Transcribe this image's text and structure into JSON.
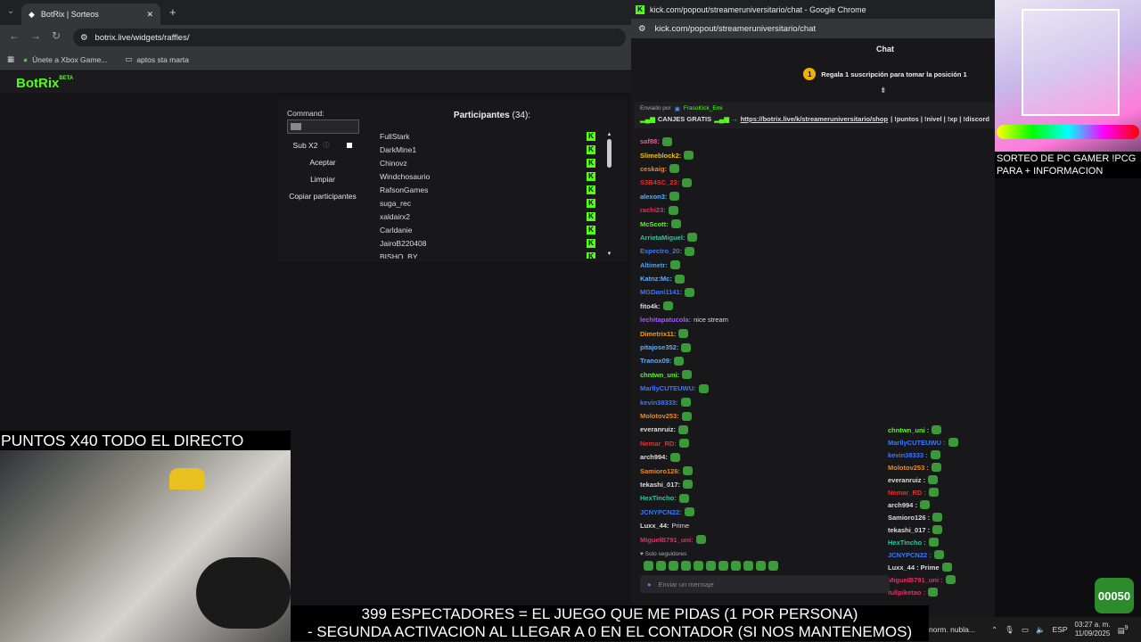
{
  "left_browser": {
    "tab_title": "BotRix | Sorteos",
    "url": "botrix.live/widgets/raffles/",
    "bookmarks": [
      "Únete a Xbox Game...",
      "aptos sta marta"
    ],
    "logo": "BotRix",
    "logo_badge": "BETA"
  },
  "raffle": {
    "command_label": "Command:",
    "sub_label": "Sub X2",
    "accept": "Aceptar",
    "clear": "Limpiar",
    "copy": "Copiar participantes",
    "title": "Participantes",
    "count": "(34):",
    "participants": [
      "FullStark",
      "DarkMine1",
      "Chinovz",
      "Windchosaurio",
      "RafsonGames",
      "suga_rec",
      "xaldairx2",
      "Carldanie",
      "JairoB220408",
      "BISHO_BY"
    ]
  },
  "promo_text": "PUNTOS X40 TODO EL DIRECTO",
  "chat_window": {
    "title": "kick.com/popout/streameruniversitario/chat - Google Chrome",
    "url": "kick.com/popout/streameruniversitario/chat",
    "header": "Chat",
    "gift_banner": "Regala 1 suscripción para tomar la posición 1",
    "gift_rank": "1",
    "pinned_sender_prefix": "Enviado por",
    "pinned_sender": "FrasoKick_Emi",
    "pinned_text": "CANJES GRATIS",
    "pinned_link": "https://botrix.live/k/streameruniversitario/shop",
    "pinned_rest": "| !puntos | !nivel | !xp | !discord",
    "messages": [
      {
        "user": "saf88:",
        "color": "#e05a9a",
        "text": ""
      },
      {
        "user": "Slimeblock2:",
        "color": "#f0c000",
        "text": ""
      },
      {
        "user": "ceskaig:",
        "color": "#e98a2a",
        "text": ""
      },
      {
        "user": "S3B4SC_23:",
        "color": "#e03030",
        "text": ""
      },
      {
        "user": "alexon3:",
        "color": "#59b0ff",
        "text": ""
      },
      {
        "user": "rachi23:",
        "color": "#e03060",
        "text": ""
      },
      {
        "user": "McScott:",
        "color": "#53fc18",
        "text": ""
      },
      {
        "user": "ArrietaMiguel:",
        "color": "#2ec4a0",
        "text": ""
      },
      {
        "user": "Espectro_20:",
        "color": "#3a78ff",
        "text": ""
      },
      {
        "user": "Altimetr:",
        "color": "#4aa0ff",
        "text": ""
      },
      {
        "user": "Katnz:Mc:",
        "color": "#59b0ff",
        "text": ""
      },
      {
        "user": "MGDani1141:",
        "color": "#3a78ff",
        "text": ""
      },
      {
        "user": "fito4k:",
        "color": "#ddd",
        "text": ""
      },
      {
        "user": "lechitapatucola:",
        "color": "#a05aff",
        "text": "nice stream"
      },
      {
        "user": "Dimetrix11:",
        "color": "#f0a000",
        "text": ""
      },
      {
        "user": "pitajose352:",
        "color": "#59b0ff",
        "text": ""
      },
      {
        "user": "Tranox09:",
        "color": "#59b0ff",
        "text": ""
      },
      {
        "user": "chntwn_uni:",
        "color": "#53fc18",
        "text": ""
      },
      {
        "user": "MarllyCUTEUWU:",
        "color": "#3a78ff",
        "text": ""
      },
      {
        "user": "kevin38333:",
        "color": "#3a78ff",
        "text": ""
      },
      {
        "user": "Molotov253:",
        "color": "#e98a2a",
        "text": ""
      },
      {
        "user": "everanruiz:",
        "color": "#ddd",
        "text": ""
      },
      {
        "user": "Nemar_RD:",
        "color": "#e03030",
        "text": ""
      },
      {
        "user": "arch994:",
        "color": "#ddd",
        "text": ""
      },
      {
        "user": "Samioro126:",
        "color": "#e98a2a",
        "text": ""
      },
      {
        "user": "tekashi_017:",
        "color": "#ddd",
        "text": ""
      },
      {
        "user": "HexTincho:",
        "color": "#2ec4a0",
        "text": ""
      },
      {
        "user": "JCNYPCN22:",
        "color": "#3a78ff",
        "text": ""
      },
      {
        "user": "Luxx_44:",
        "color": "#ddd",
        "text": "Prime"
      },
      {
        "user": "MiguelB791_uni:",
        "color": "#e03060",
        "text": ""
      }
    ],
    "mirror": [
      {
        "user": "chntwn_uni :",
        "color": "#53fc18"
      },
      {
        "user": "MarllyCUTEUWU :",
        "color": "#3a78ff"
      },
      {
        "user": "kevin38333 :",
        "color": "#3a78ff"
      },
      {
        "user": "Molotov253 :",
        "color": "#e98a2a"
      },
      {
        "user": "everanruiz :",
        "color": "#ddd"
      },
      {
        "user": "Nemar_RD :",
        "color": "#e03030"
      },
      {
        "user": "arch994 :",
        "color": "#ddd"
      },
      {
        "user": "Samioro126 :",
        "color": "#ddd"
      },
      {
        "user": "tekashi_017 :",
        "color": "#ddd"
      },
      {
        "user": "HexTincho :",
        "color": "#2ec4a0"
      },
      {
        "user": "JCNYPCN22 :",
        "color": "#3a78ff"
      },
      {
        "user": "Luxx_44 : Prime",
        "color": "#ddd"
      },
      {
        "user": "MiguelB791_uni :",
        "color": "#e03060"
      },
      {
        "user": "fullpiketao :",
        "color": "#e03060"
      }
    ],
    "followers_only": "Solo seguidores",
    "send_placeholder": "Enviar un mensaje"
  },
  "ad": {
    "text": "SORTEO DE PC GAMER !PCG PARA + INFORMACION"
  },
  "captions": {
    "line1": "399 ESPECTADORES = EL JUEGO QUE ME PIDAS (1 POR PERSONA)",
    "line2": "- SEGUNDA ACTIVACION AL LLEGAR A 0 EN EL CONTADOR (SI NOS MANTENEMOS)"
  },
  "taskbar": {
    "weather": "norm. nubla...",
    "lang": "ESP",
    "time": "03:27 a. m.",
    "date": "11/09/2025",
    "notif": "9"
  },
  "badge_text": "00050",
  "colors": {
    "kick_green": "#53fc18"
  }
}
